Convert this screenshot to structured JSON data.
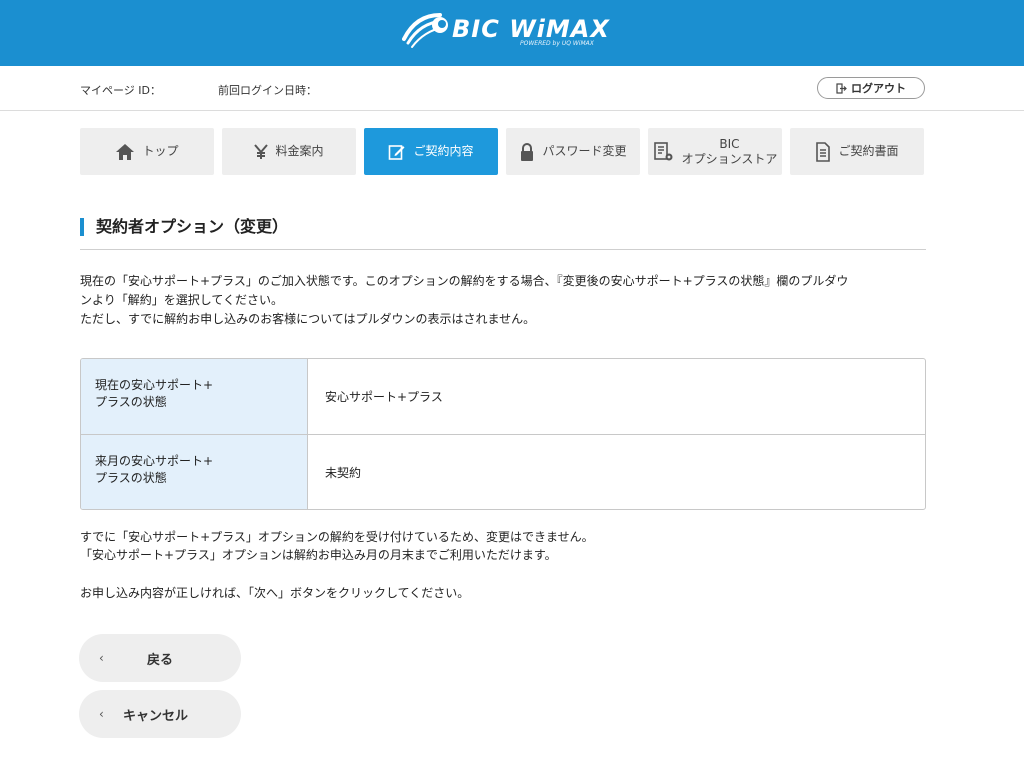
{
  "header": {
    "logo_text": "BIC WiMAX",
    "logo_sub": "POWERED by UQ WiMAX",
    "brand_color": "#1b8fd0"
  },
  "userbar": {
    "mypage_id_label": "マイページ ID：",
    "last_login_label": "前回ログイン日時：",
    "logout_label": "ログアウト",
    "logout_icon": "logout-icon"
  },
  "nav": {
    "items": [
      {
        "label": "トップ",
        "icon": "home-icon"
      },
      {
        "label": "料金案内",
        "icon": "yen-icon"
      },
      {
        "label": "ご契約内容",
        "icon": "edit-icon",
        "active": true
      },
      {
        "label": "パスワード変更",
        "icon": "lock-icon"
      },
      {
        "label_line1": "BIC",
        "label_line2": "オプションストア",
        "icon": "store-settings-icon"
      },
      {
        "label": "ご契約書面",
        "icon": "document-icon"
      }
    ],
    "active_color": "#1e99dc"
  },
  "section": {
    "title": "契約者オプション（変更）"
  },
  "description": {
    "line1": "現在の「安心サポート+プラス」のご加入状態です。このオプションの解約をする場合、『変更後の安心サポート+プラスの状態』欄のプルダウ",
    "line2": "ンより「解約」を選択してください。",
    "line3": "ただし、すでに解約お申し込みのお客様についてはプルダウンの表示はされません。"
  },
  "table": {
    "rows": [
      {
        "head_line1": "現在の安心サポート+",
        "head_line2": "プラスの状態",
        "value": "安心サポート+プラス"
      },
      {
        "head_line1": "来月の安心サポート+",
        "head_line2": "プラスの状態",
        "value": "未契約"
      }
    ],
    "head_bg": "#e3f0fb"
  },
  "notes": {
    "line1": "すでに「安心サポート+プラス」オプションの解約を受け付けているため、変更はできません。",
    "line2": "「安心サポート+プラス」オプションは解約お申込み月の月末までご利用いただけます。"
  },
  "confirm_text": "お申し込み内容が正しければ、「次へ」ボタンをクリックしてください。",
  "buttons": {
    "back_label": "戻る",
    "cancel_label": "キャンセル",
    "chevron": "‹"
  }
}
